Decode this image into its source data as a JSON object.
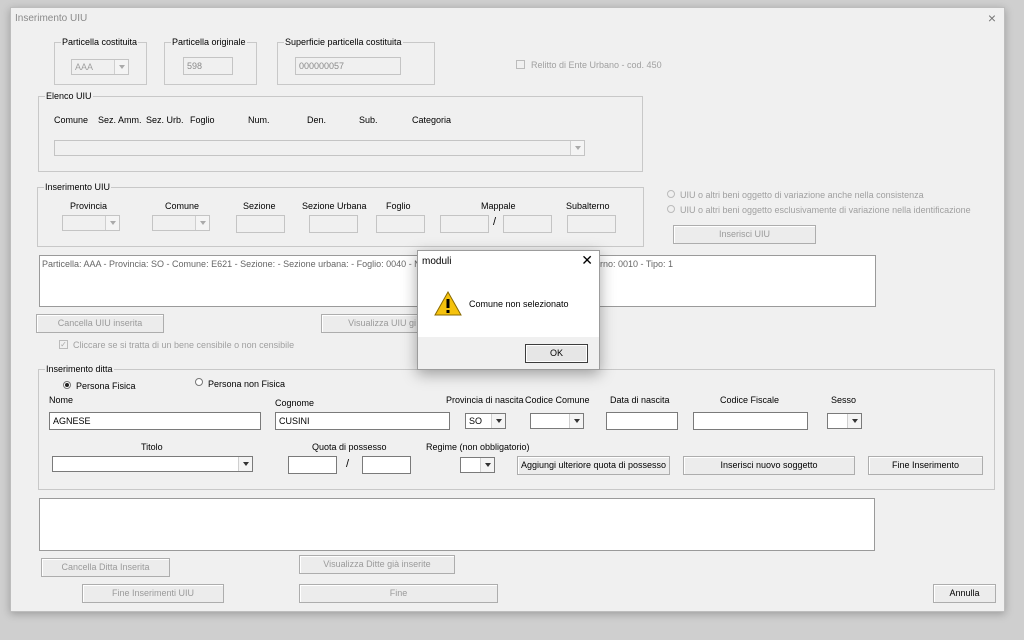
{
  "window": {
    "title": "Inserimento UIU",
    "close_glyph": "×"
  },
  "top": {
    "particella_costituita": {
      "label": "Particella costituita",
      "value": "AAA"
    },
    "particella_originale": {
      "label": "Particella originale",
      "value": "598"
    },
    "superficie": {
      "label": "Superficie particella costituita",
      "value": "000000057"
    },
    "relitto": {
      "label": "Relitto di Ente Urbano - cod. 450",
      "checked": false
    }
  },
  "elenco_uiu": {
    "label": "Elenco UIU",
    "columns": [
      "Comune",
      "Sez. Amm.",
      "Sez. Urb.",
      "Foglio",
      "Num.",
      "Den.",
      "Sub.",
      "Categoria"
    ]
  },
  "inserimento_uiu": {
    "label": "Inserimento UIU",
    "fields": {
      "provincia": "Provincia",
      "comune": "Comune",
      "sezione": "Sezione",
      "sezione_urbana": "Sezione Urbana",
      "foglio": "Foglio",
      "mappale": "Mappale",
      "subalterno": "Subalterno"
    },
    "slash": "/"
  },
  "variazione": {
    "option1": "UIU o altri beni oggetto di variazione anche nella consistenza",
    "option2": "UIU o altri beni oggetto esclusivamente di variazione nella identificazione",
    "inserisci_button": "Inserisci UIU"
  },
  "uiu_list": {
    "line_left": "Particella: AAA - Provincia: SO - Comune: E621 - Sezione:   - Sezione urbana:   - Foglio: 0040 - N",
    "line_right": "rno: 0010 - Tipo: 1"
  },
  "uiu_actions": {
    "cancella": "Cancella UIU inserita",
    "visualizza": "Visualizza UIU gi",
    "sensibile": "Cliccare se si tratta di un bene censibile o non censibile"
  },
  "ditta": {
    "label": "Inserimento ditta",
    "persona_fisica": "Persona Fisica",
    "persona_non_fisica": "Persona non Fisica",
    "nome_label": "Nome",
    "nome_value": "AGNESE",
    "cognome_label": "Cognome",
    "cognome_value": "CUSINI",
    "provincia_label": "Provincia di nascita",
    "provincia_value": "SO",
    "codice_comune_label": "Codice Comune",
    "data_nascita_label": "Data di nascita",
    "codice_fiscale_label": "Codice Fiscale",
    "sesso_label": "Sesso",
    "titolo_label": "Titolo",
    "quota_label": "Quota di possesso",
    "regime_label": "Regime (non obbligatorio)",
    "slash": "/",
    "aggiungi_button": "Aggiungi ulteriore quota di possesso",
    "inserisci_soggetto_button": "Inserisci nuovo soggetto",
    "fine_inserimento_button": "Fine Inserimento"
  },
  "bottom": {
    "cancella_ditta": "Cancella Ditta Inserita",
    "visualizza_ditte": "Visualizza Ditte già inserite",
    "fine_uiu": "Fine Inserimenti UIU",
    "fine": "Fine",
    "annulla": "Annulla"
  },
  "dialog": {
    "title": "moduli",
    "close_glyph": "✕",
    "message": "Comune non selezionato",
    "icon": "warning-icon",
    "ok": "OK"
  }
}
